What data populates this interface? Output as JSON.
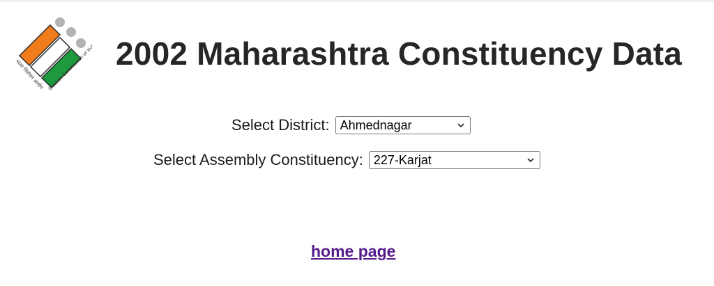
{
  "header": {
    "title": "2002 Maharashtra Constituency Data",
    "logo": {
      "icon": "election-commission-logo",
      "caption_left": "भारत निर्वाचन आयोग",
      "caption_right": "Election Commission of India",
      "colors": {
        "saffron": "#f07c1c",
        "green": "#1e9a3e",
        "dots": "#b3b3b3",
        "border": "#2a2a2a"
      }
    }
  },
  "form": {
    "district": {
      "label": "Select District:",
      "selected": "Ahmednagar"
    },
    "assembly": {
      "label": "Select Assembly Constituency:",
      "selected": "227-Karjat"
    }
  },
  "footer": {
    "home_link": "home page",
    "link_color": "#551a8b"
  }
}
